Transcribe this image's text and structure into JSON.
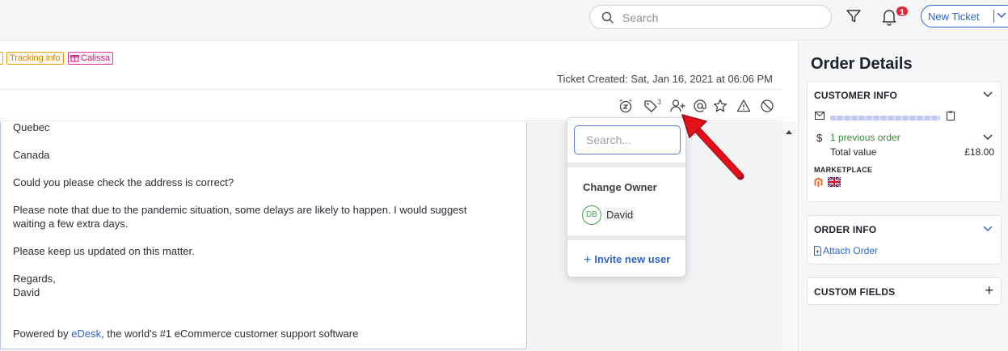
{
  "topbar": {
    "search_placeholder": "Search",
    "notification_count": "1",
    "new_ticket_label": "New Ticket"
  },
  "ticket": {
    "tags": [
      "Tracking info",
      "Calissa"
    ],
    "created": "Ticket Created: Sat, Jan 16, 2021 at 06:06 PM",
    "tag_count": "3",
    "toolbar_icons": [
      "snooze-icon",
      "tag-icon",
      "assign-user-icon",
      "mention-icon",
      "star-icon",
      "warning-icon",
      "block-icon"
    ]
  },
  "message": {
    "lines": [
      "Quebec",
      "Canada",
      "Could you please check the address is correct?",
      "Please note that due to the pandemic situation, some delays are likely to happen. I would suggest",
      "waiting a few extra days.",
      "Please keep us updated on this matter.",
      "Regards,",
      "David"
    ],
    "footer_prefix": "Powered by ",
    "footer_link": "eDesk",
    "footer_suffix": ", the world's #1 eCommerce customer support software"
  },
  "owner_popup": {
    "search_placeholder": "Search...",
    "heading": "Change Owner",
    "users": [
      {
        "initials": "DB",
        "name": "David"
      }
    ],
    "invite_label": "Invite new user"
  },
  "sidebar": {
    "title": "Order Details",
    "customer_info": {
      "title": "CUSTOMER INFO",
      "previous_orders": "1 previous order",
      "total_label": "Total value",
      "total_value": "£18.00",
      "marketplace_label": "MARKETPLACE"
    },
    "order_info": {
      "title": "ORDER INFO",
      "attach_label": "Attach Order"
    },
    "custom_fields": {
      "title": "CUSTOM FIELDS"
    }
  },
  "colors": {
    "accent": "#2f64c9",
    "badge": "#e02a3a",
    "arrow": "#e3101a",
    "tracking_tag": "#e8a100",
    "calissa_tag": "#e0389a"
  }
}
